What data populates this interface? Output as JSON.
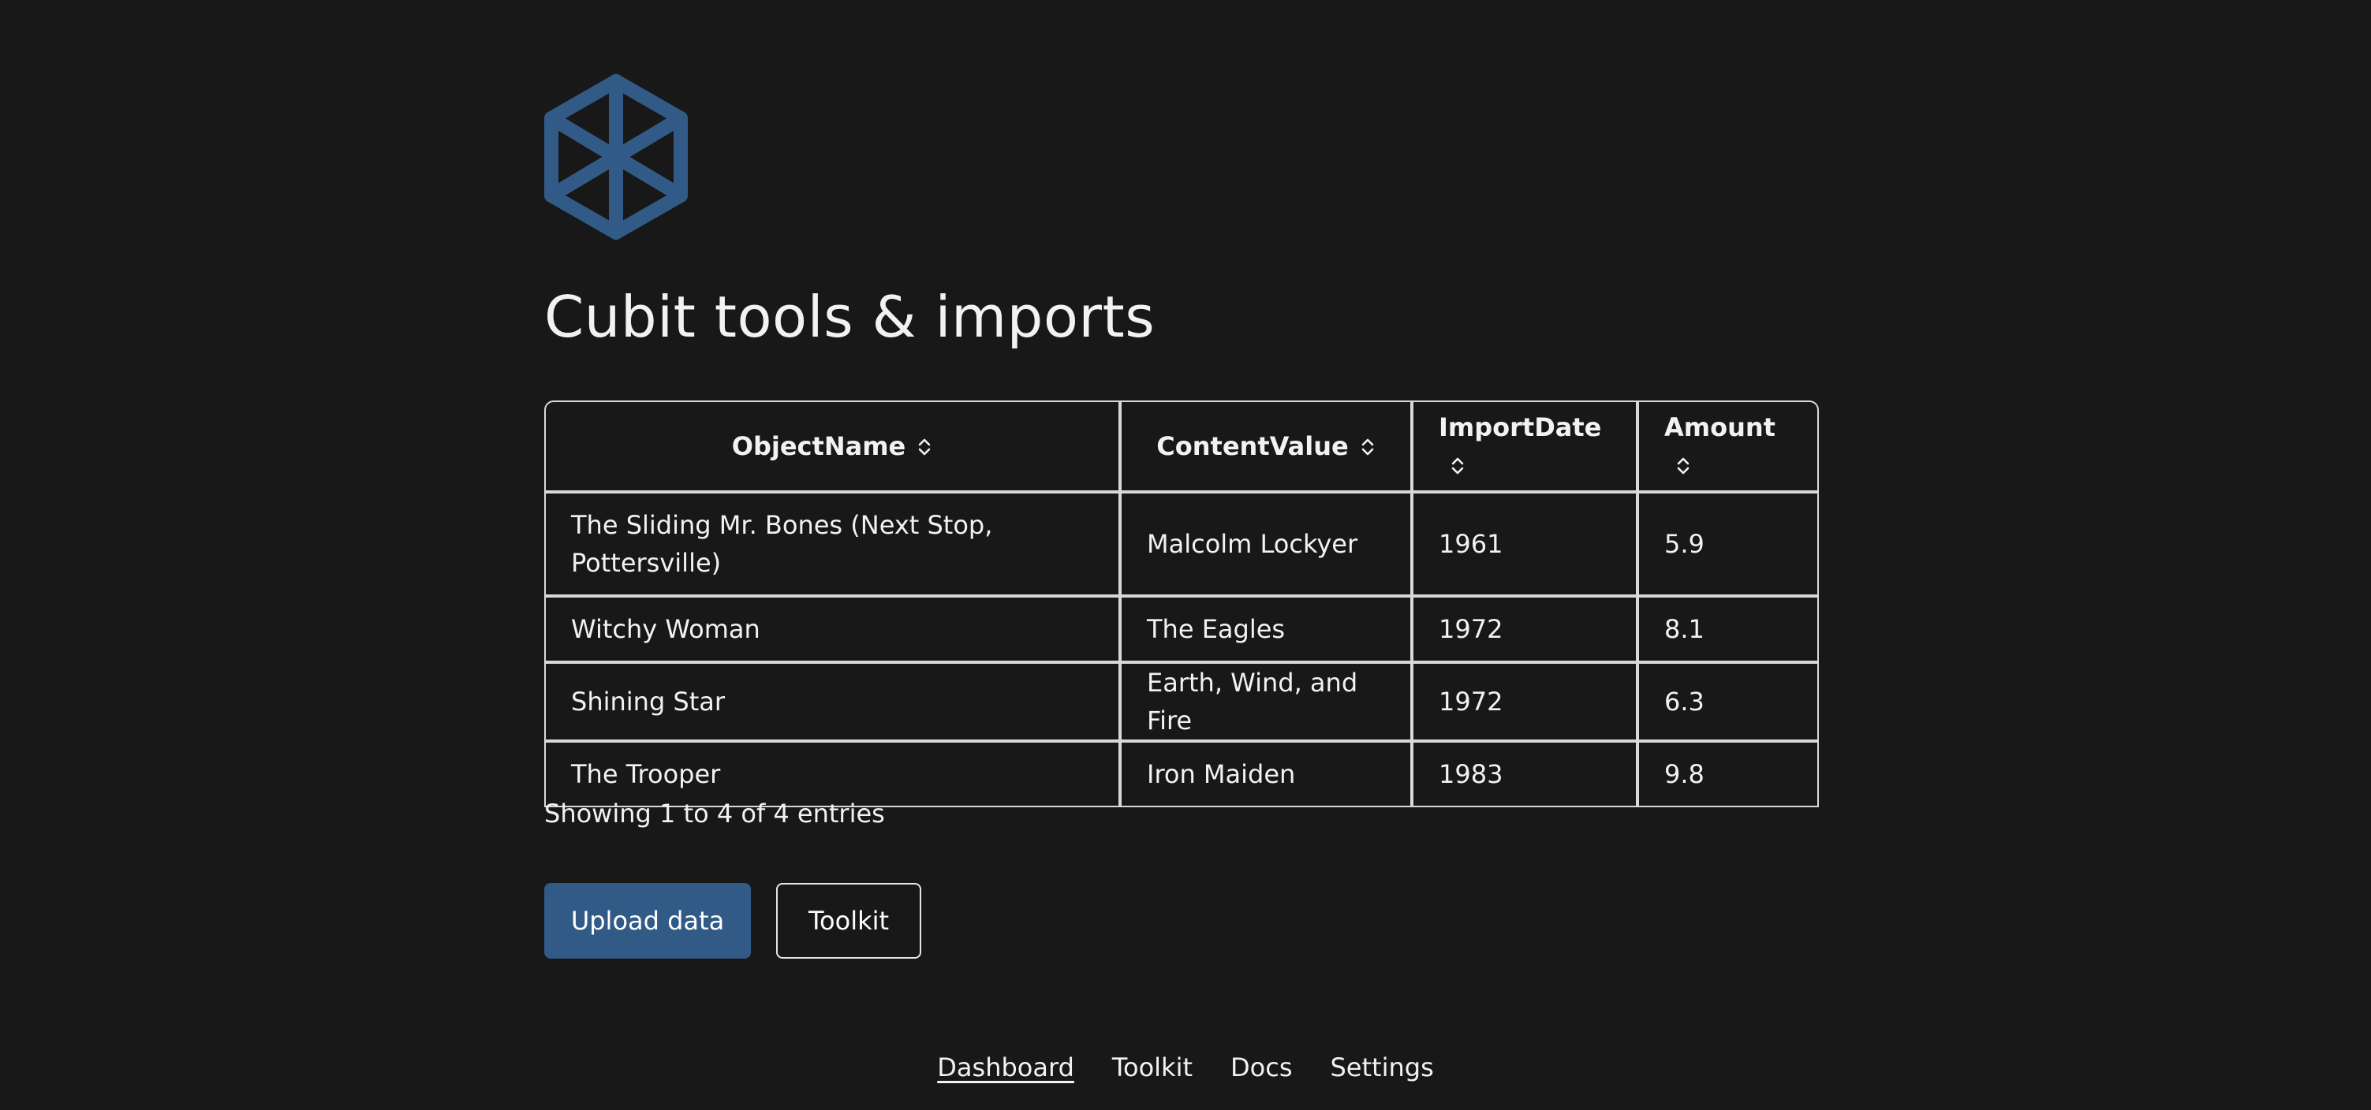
{
  "app": {
    "logo": "cubit-logo-icon",
    "title": "Cubit tools & imports"
  },
  "table": {
    "columns": [
      {
        "label": "ObjectName",
        "sort_icon": "sort-icon"
      },
      {
        "label": "ContentValue",
        "sort_icon": "sort-icon"
      },
      {
        "label": "ImportDate",
        "sort_icon": "sort-icon"
      },
      {
        "label": "Amount",
        "sort_icon": "sort-icon"
      }
    ],
    "rows": [
      [
        "The Sliding Mr. Bones (Next Stop, Pottersville)",
        "Malcolm Lockyer",
        "1961",
        "5.9"
      ],
      [
        "Witchy Woman",
        "The Eagles",
        "1972",
        "8.1"
      ],
      [
        "Shining Star",
        "Earth, Wind, and Fire",
        "1972",
        "6.3"
      ],
      [
        "The Trooper",
        "Iron Maiden",
        "1983",
        "9.8"
      ]
    ],
    "info": "Showing 1 to 4 of 4 entries"
  },
  "actions": {
    "upload_label": "Upload data",
    "toolkit_label": "Toolkit"
  },
  "footer": {
    "links": [
      {
        "label": "Dashboard",
        "active": true
      },
      {
        "label": "Toolkit",
        "active": false
      },
      {
        "label": "Docs",
        "active": false
      },
      {
        "label": "Settings",
        "active": false
      }
    ]
  },
  "colors": {
    "background": "#181818",
    "accent": "#325a86",
    "text": "#f2f2f2",
    "border": "#d9d9d9"
  }
}
